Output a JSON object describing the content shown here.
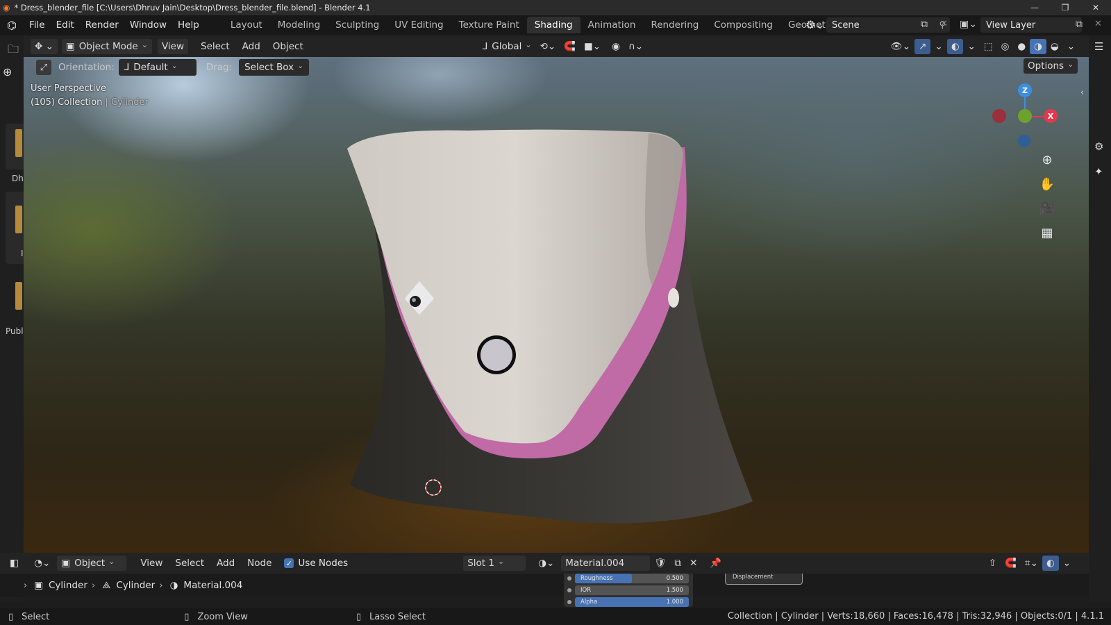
{
  "titlebar": {
    "title": "* Dress_blender_file [C:\\Users\\Dhruv Jain\\Desktop\\Dress_blender_file.blend] - Blender 4.1"
  },
  "menu": [
    "File",
    "Edit",
    "Render",
    "Window",
    "Help"
  ],
  "workspaces": [
    "Layout",
    "Modeling",
    "Sculpting",
    "UV Editing",
    "Texture Paint",
    "Shading",
    "Animation",
    "Rendering",
    "Compositing",
    "Geometry N"
  ],
  "active_workspace": "Shading",
  "scene": "Scene",
  "view_layer": "View Layer",
  "viewport_header": {
    "mode": "Object Mode",
    "menus": [
      "View",
      "Select",
      "Add",
      "Object"
    ],
    "transform_orientation": "Global",
    "options": "Options"
  },
  "tool_settings": {
    "orientation_label": "Orientation:",
    "orientation_value": "Default",
    "drag_label": "Drag:",
    "drag_value": "Select Box"
  },
  "viewport": {
    "perspective": "User Perspective",
    "collection_info": "(105) Collection",
    "object_name": "Cylinder",
    "gizmo": {
      "z": "Z",
      "x": "X"
    }
  },
  "left_strip": {
    "labels": [
      "Dh",
      "I",
      "Publ"
    ]
  },
  "node_editor": {
    "editor_type": "Object",
    "menus": [
      "View",
      "Select",
      "Add",
      "Node"
    ],
    "use_nodes_label": "Use Nodes",
    "use_nodes_checked": true,
    "slot": "Slot 1",
    "material": "Material.004",
    "breadcrumb": [
      "Cylinder",
      "Cylinder",
      "Material.004"
    ],
    "node_inputs": [
      {
        "name": "Roughness",
        "value": "0.500",
        "fill": 0.5
      },
      {
        "name": "IOR",
        "value": "1.500",
        "fill": 0.0
      },
      {
        "name": "Alpha",
        "value": "1.000",
        "fill": 1.0
      }
    ],
    "displacement_label": "Displacement"
  },
  "statusbar": {
    "hints": [
      "Select",
      "Zoom View",
      "Lasso Select"
    ],
    "stats": "Collection | Cylinder | Verts:18,660 | Faces:16,478 | Tris:32,946 | Objects:0/1 | 4.1.1"
  },
  "colors": {
    "accent_active": "#4772b3",
    "axis_x": "#e3394f",
    "axis_y": "#6da32d",
    "axis_z": "#3d8ee1",
    "dress_trim": "#c06aa6"
  }
}
